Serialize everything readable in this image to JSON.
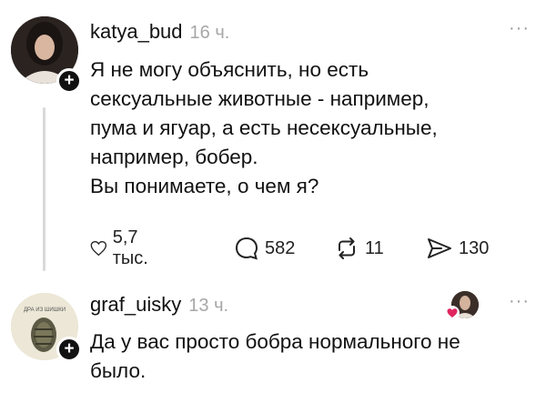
{
  "posts": [
    {
      "username": "katya_bud",
      "time": "16 ч.",
      "more": "···",
      "text": "Я не могу объяснить, но есть\nсексуальные животные - например,\nпума и ягуар, а есть несексуальные,\nнапример, бобер.\nВы понимаете, о чем я?",
      "actions": {
        "likes": "5,7 тыс.",
        "replies": "582",
        "reposts": "11",
        "shares": "130"
      }
    },
    {
      "username": "graf_uisky",
      "time": "13 ч.",
      "more": "···",
      "text": "Да у вас просто бобра нормального не\nбыло.",
      "avatar_text": "ДРА ИЗ ШИШКИ"
    }
  ],
  "icons": {
    "like": "heart-outline-icon",
    "reply": "speech-bubble-icon",
    "repost": "repost-arrows-icon",
    "share": "paper-plane-icon",
    "liked_badge": "red-heart-icon"
  },
  "colors": {
    "text": "#111111",
    "muted": "#a7a7a7",
    "like_red": "#e0245e"
  }
}
